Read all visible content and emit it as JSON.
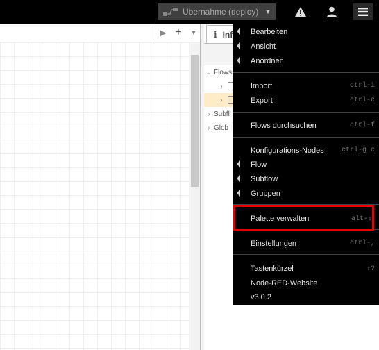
{
  "header": {
    "deploy_label": "Übernahme (deploy)"
  },
  "sidebar": {
    "tab_label": "Inf",
    "tree": [
      {
        "label": "Flows",
        "expanded": true
      },
      {
        "label": "",
        "child": true
      },
      {
        "label": "",
        "child": true,
        "selected": true
      },
      {
        "label": "Subfl",
        "expanded": false
      },
      {
        "label": "Glob",
        "expanded": false
      }
    ]
  },
  "menu": {
    "items": [
      {
        "label": "Bearbeiten",
        "submenu": true,
        "shortcut": ""
      },
      {
        "label": "Ansicht",
        "submenu": true,
        "shortcut": ""
      },
      {
        "label": "Anordnen",
        "submenu": true,
        "shortcut": ""
      },
      {
        "label": "Import",
        "submenu": false,
        "shortcut": "ctrl-i"
      },
      {
        "label": "Export",
        "submenu": false,
        "shortcut": "ctrl-e"
      },
      {
        "label": "Flows durchsuchen",
        "submenu": false,
        "shortcut": "ctrl-f"
      },
      {
        "label": "Konfigurations-Nodes",
        "submenu": false,
        "shortcut": "ctrl-g c"
      },
      {
        "label": "Flow",
        "submenu": true,
        "shortcut": ""
      },
      {
        "label": "Subflow",
        "submenu": true,
        "shortcut": ""
      },
      {
        "label": "Gruppen",
        "submenu": true,
        "shortcut": ""
      },
      {
        "label": "Palette verwalten",
        "submenu": false,
        "shortcut": "alt-⇧"
      },
      {
        "label": "Einstellungen",
        "submenu": false,
        "shortcut": "ctrl-,"
      },
      {
        "label": "Tastenkürzel",
        "submenu": false,
        "shortcut": "⇧?"
      },
      {
        "label": "Node-RED-Website",
        "submenu": false,
        "shortcut": ""
      },
      {
        "label": "v3.0.2",
        "submenu": false,
        "shortcut": ""
      }
    ]
  },
  "colors": {
    "highlight": "#e60000",
    "menu_bg": "#000000"
  }
}
